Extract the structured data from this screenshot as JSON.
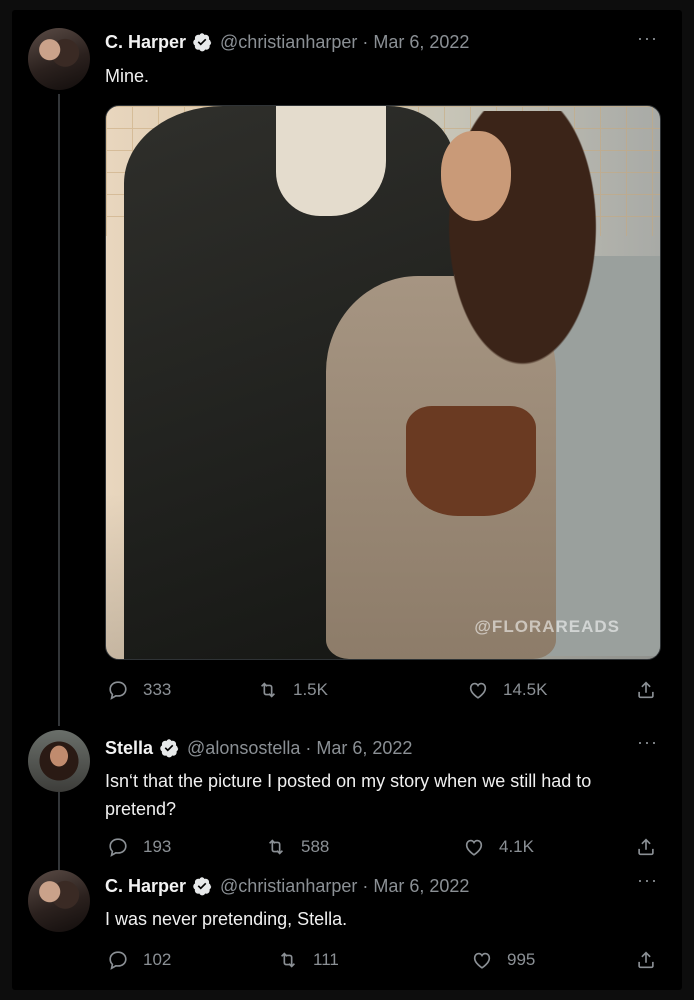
{
  "tweets": [
    {
      "name": "C. Harper",
      "handle": "@christianharper",
      "dot": "·",
      "date": "Mar 6, 2022",
      "more": "···",
      "text": "Mine.",
      "media_watermark": "@FLORAREADS",
      "replies": "333",
      "retweets": "1.5K",
      "likes": "14.5K"
    },
    {
      "name": "Stella",
      "handle": "@alonsostella",
      "dot": "·",
      "date": "Mar 6, 2022",
      "more": "···",
      "text": "Isn‘t that the picture I posted on my story when we still had to pretend?",
      "replies": "193",
      "retweets": "588",
      "likes": "4.1K"
    },
    {
      "name": "C. Harper",
      "handle": "@christianharper",
      "dot": "·",
      "date": "Mar 6, 2022",
      "more": "···",
      "text": "I was never pretending, Stella.",
      "replies": "102",
      "retweets": "111",
      "likes": "995"
    }
  ],
  "colors": {
    "background": "#000000",
    "text": "#e7e9ea",
    "muted": "#8b9095",
    "verified": "#e7e9ea"
  },
  "icons": [
    "reply-icon",
    "retweet-icon",
    "like-icon",
    "share-icon",
    "verified-badge-icon",
    "more-icon"
  ]
}
